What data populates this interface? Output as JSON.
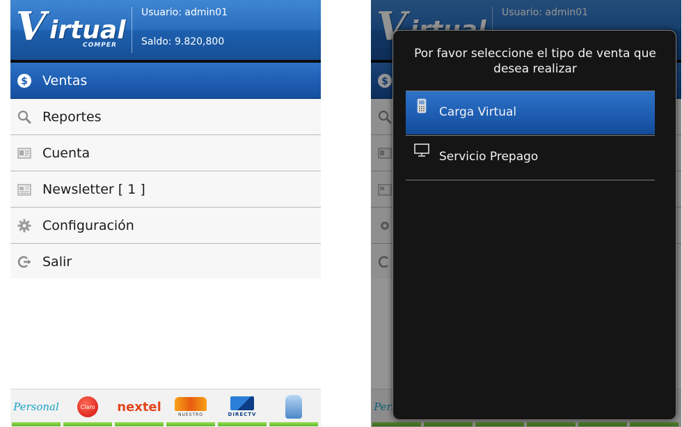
{
  "header": {
    "logo_main": "irtual",
    "logo_v": "V",
    "logo_sub": "COMPER",
    "user_line": "Usuario: admin01",
    "balance_line": "Saldo: 9.820,800"
  },
  "menu": {
    "items": [
      {
        "label": "Ventas",
        "icon": "dollar-coin-icon",
        "selected": true
      },
      {
        "label": "Reportes",
        "icon": "search-icon"
      },
      {
        "label": "Cuenta",
        "icon": "id-card-icon"
      },
      {
        "label": "Newsletter [ 1 ]",
        "icon": "newspaper-icon"
      },
      {
        "label": "Configuración",
        "icon": "gear-icon"
      },
      {
        "label": "Salir",
        "icon": "logout-arrow-icon"
      }
    ]
  },
  "carriers": [
    {
      "name": "Personal",
      "text": "Personal"
    },
    {
      "name": "Claro",
      "text": "Claro"
    },
    {
      "name": "Nextel",
      "text": "nextel"
    },
    {
      "name": "Nuestro",
      "text": "NUESTRO"
    },
    {
      "name": "DirecTV",
      "text": "DIRECTV"
    },
    {
      "name": "Mascot"
    }
  ],
  "dialog": {
    "title": "Por favor seleccione el tipo de venta que desea realizar",
    "options": [
      {
        "label": "Carga Virtual",
        "icon": "mobile-phone-icon",
        "selected": true
      },
      {
        "label": "Servicio Prepago",
        "icon": "monitor-icon"
      }
    ]
  },
  "colors": {
    "header_blue": "#2a6fbf",
    "selection_blue": "#1f5fb4",
    "dialog_bg": "#151515",
    "carrier_green": "#5fb52a"
  }
}
